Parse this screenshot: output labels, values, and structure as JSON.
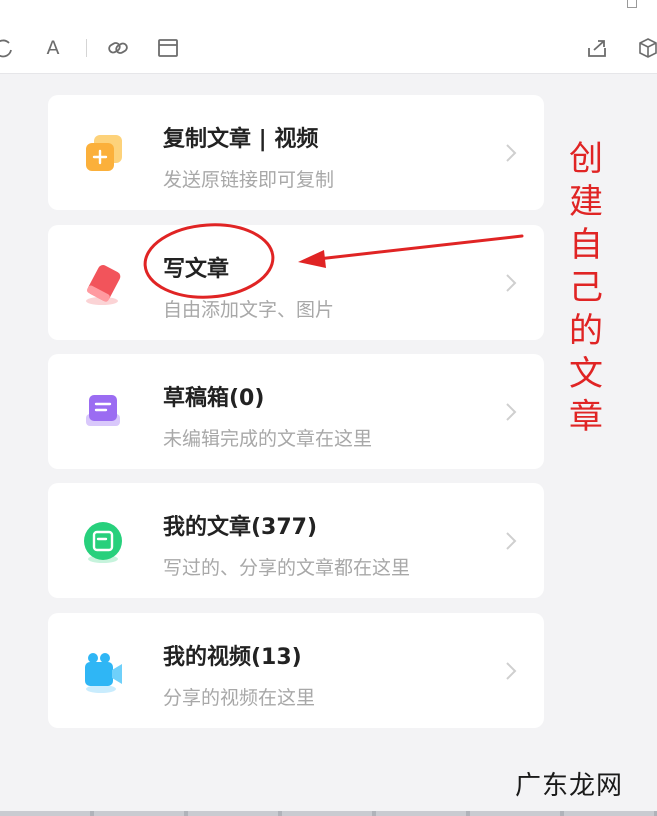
{
  "cards": [
    {
      "title": "复制文章 | 视频",
      "subtitle": "发送原链接即可复制",
      "icon": "copy-icon"
    },
    {
      "title": "写文章",
      "subtitle": "自由添加文字、图片",
      "icon": "pen-icon"
    },
    {
      "title": "草稿箱(0)",
      "subtitle": "未编辑完成的文章在这里",
      "icon": "inbox-icon"
    },
    {
      "title": "我的文章(377)",
      "subtitle": "写过的、分享的文章都在这里",
      "icon": "article-icon"
    },
    {
      "title": "我的视频(13)",
      "subtitle": "分享的视频在这里",
      "icon": "video-icon"
    }
  ],
  "toolbar": {
    "font_label": "A"
  },
  "annotation": {
    "chars": [
      "创",
      "建",
      "自",
      "己",
      "的",
      "文",
      "章"
    ],
    "color": "#e02424"
  },
  "watermark": "广东龙网",
  "colors": {
    "copy": "#fbb03b",
    "pen": "#f2545b",
    "inbox": "#9b6cf2",
    "article": "#27d07c",
    "video": "#2fb6f5"
  }
}
